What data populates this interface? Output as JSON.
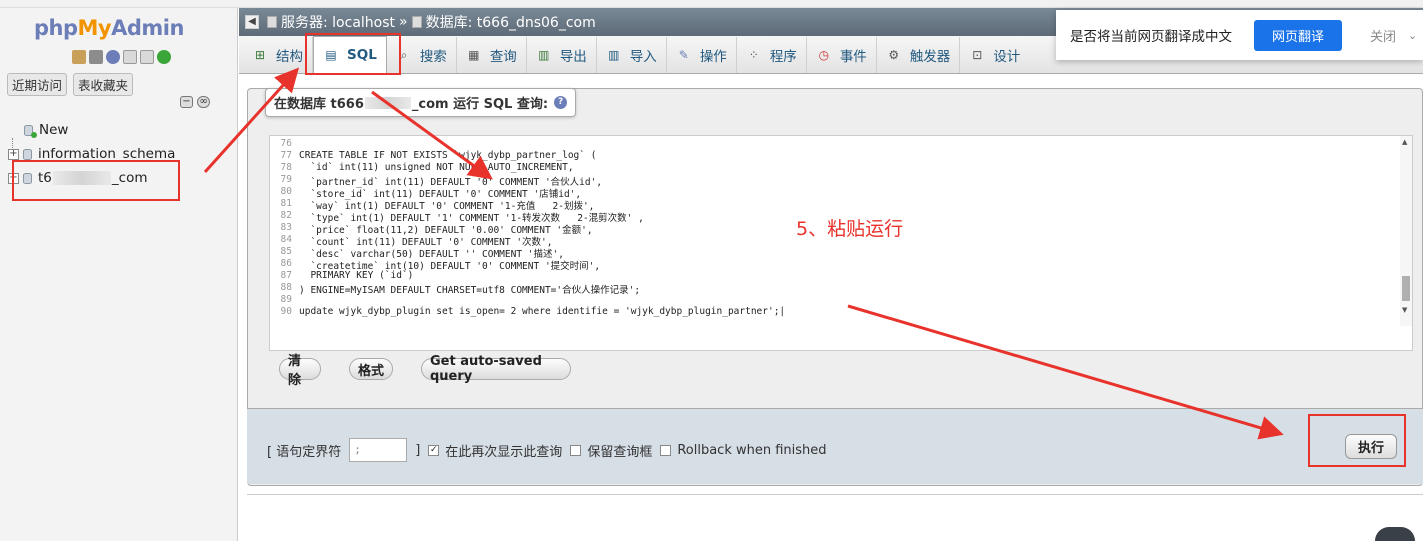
{
  "nav": {
    "logo_php": "php",
    "logo_my": "My",
    "logo_admin": "Admin",
    "recent_btn": "近期访问",
    "fav_btn": "表收藏夹",
    "tree": [
      {
        "label": "New"
      },
      {
        "label": "information_schema"
      },
      {
        "label_start": "t6",
        "label_end": "_com"
      }
    ]
  },
  "breadcrumb": {
    "server": "服务器: localhost",
    "sep": "»",
    "database": "数据库: t666_dns06_com"
  },
  "tabs": [
    {
      "label": "结构",
      "icon": "structure-icon"
    },
    {
      "label": "SQL",
      "icon": "sql-icon",
      "active": true
    },
    {
      "label": "搜索",
      "icon": "search-icon"
    },
    {
      "label": "查询",
      "icon": "query-icon"
    },
    {
      "label": "导出",
      "icon": "export-icon"
    },
    {
      "label": "导入",
      "icon": "import-icon"
    },
    {
      "label": "操作",
      "icon": "wrench-icon"
    },
    {
      "label": "程序",
      "icon": "routines-icon"
    },
    {
      "label": "事件",
      "icon": "clock-icon"
    },
    {
      "label": "触发器",
      "icon": "trigger-icon"
    },
    {
      "label": "设计",
      "icon": "designer-icon"
    }
  ],
  "translate_bar": {
    "text": "是否将当前网页翻译成中文",
    "translate_btn": "网页翻译",
    "close": "关闭",
    "dropdown": "⌄"
  },
  "caption": {
    "prefix": "在数据库 t666",
    "suffix": "_com 运行 SQL 查询:"
  },
  "editor": {
    "lines": [
      {
        "n": "76",
        "t": ""
      },
      {
        "n": "77",
        "t": "CREATE TABLE IF NOT EXISTS `wjyk_dybp_partner_log` ("
      },
      {
        "n": "78",
        "t": "  `id` int(11) unsigned NOT NULL AUTO_INCREMENT,"
      },
      {
        "n": "79",
        "t": "  `partner_id` int(11) DEFAULT '0' COMMENT '合伙人id',"
      },
      {
        "n": "80",
        "t": "  `store_id` int(11) DEFAULT '0' COMMENT '店铺id',"
      },
      {
        "n": "81",
        "t": "  `way` int(1) DEFAULT '0' COMMENT '1-充值   2-划拨',"
      },
      {
        "n": "82",
        "t": "  `type` int(1) DEFAULT '1' COMMENT '1-转发次数   2-混剪次数' ,"
      },
      {
        "n": "83",
        "t": "  `price` float(11,2) DEFAULT '0.00' COMMENT '金额',"
      },
      {
        "n": "84",
        "t": "  `count` int(11) DEFAULT '0' COMMENT '次数',"
      },
      {
        "n": "85",
        "t": "  `desc` varchar(50) DEFAULT '' COMMENT '描述',"
      },
      {
        "n": "86",
        "t": "  `createtime` int(10) DEFAULT '0' COMMENT '提交时间',"
      },
      {
        "n": "87",
        "t": "  PRIMARY KEY (`id`)"
      },
      {
        "n": "88",
        "t": ") ENGINE=MyISAM DEFAULT CHARSET=utf8 COMMENT='合伙人操作记录';"
      },
      {
        "n": "89",
        "t": ""
      },
      {
        "n": "90",
        "t": "update wjyk_dybp_plugin set is_open= 2 where identifie = 'wjyk_dybp_plugin_partner';|"
      }
    ]
  },
  "buttons": {
    "clear": "清除",
    "format": "格式",
    "autosaved": "Get auto-saved query",
    "execute": "执行"
  },
  "options": {
    "delimiter_label_open": "[ 语句定界符",
    "delimiter_value": ";",
    "delimiter_label_close": "]",
    "show_again": "在此再次显示此查询",
    "keep_box": "保留查询框",
    "rollback": "Rollback when finished"
  },
  "annotation": {
    "step": "5、粘贴运行"
  },
  "colors": {
    "annotation_red": "#e8332c",
    "header_bg": "#6b7a87",
    "translate_btn": "#1a73e8"
  }
}
